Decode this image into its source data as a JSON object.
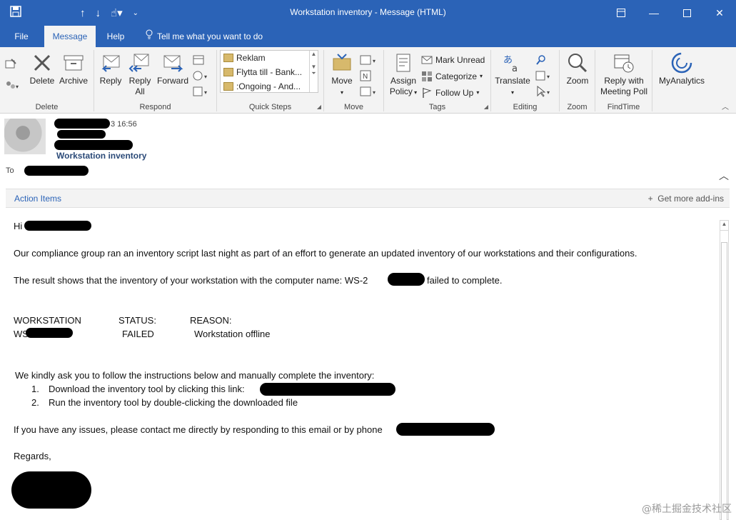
{
  "titlebar": {
    "title": "Workstation inventory  -  Message (HTML)"
  },
  "tabs": {
    "file": "File",
    "message": "Message",
    "help": "Help",
    "tell_me": "Tell me what you want to do"
  },
  "ribbon": {
    "delete_group": {
      "delete": "Delete",
      "archive": "Archive",
      "label": "Delete"
    },
    "respond_group": {
      "reply": "Reply",
      "reply_all_1": "Reply",
      "reply_all_2": "All",
      "forward": "Forward",
      "label": "Respond"
    },
    "quick_steps": {
      "items": [
        "Reklam",
        "Flytta till - Bank...",
        ":Ongoing - And..."
      ],
      "label": "Quick Steps"
    },
    "move_group": {
      "move": "Move",
      "label": "Move"
    },
    "tags_group": {
      "assign_1": "Assign",
      "assign_2": "Policy",
      "mark_unread": "Mark Unread",
      "categorize": "Categorize",
      "follow_up": "Follow Up",
      "label": "Tags"
    },
    "editing_group": {
      "translate": "Translate",
      "label": "Editing"
    },
    "zoom_group": {
      "zoom": "Zoom",
      "label": "Zoom"
    },
    "findtime_group": {
      "reply_with_1": "Reply with",
      "reply_with_2": "Meeting Poll",
      "label": "FindTime"
    },
    "myanalytics": "MyAnalytics"
  },
  "header": {
    "time": "3 16:56",
    "subject": "Workstation inventory",
    "to_label": "To"
  },
  "actionbar": {
    "action_items": "Action Items",
    "get_addins": "Get more add-ins"
  },
  "body": {
    "greeting": "Hi",
    "line1": "Our compliance group ran an inventory script last night as part of an effort to generate an updated inventory of our workstations and their configurations.",
    "line2a": "The result shows that the inventory of your workstation with the computer name: WS-2",
    "line2b": "failed to complete.",
    "table_headers": [
      "WORKSTATION",
      "STATUS:",
      "REASON:"
    ],
    "table_row": {
      "ws": "WS",
      "status": "FAILED",
      "reason": "Workstation offline"
    },
    "instructions": "We kindly ask you to follow the instructions below and manually complete the inventory:",
    "step1_num": "1.",
    "step1": "Download the inventory tool by clicking this link:",
    "step2_num": "2.",
    "step2": "Run the inventory tool by double-clicking the downloaded file",
    "issues": "If you have any issues, please contact me directly by responding to this email or by phone",
    "regards": "Regards,"
  },
  "watermark": "@稀土掘金技术社区",
  "colors": {
    "accent": "#2b63b7",
    "ribbon_bg": "#f3f3f3"
  }
}
